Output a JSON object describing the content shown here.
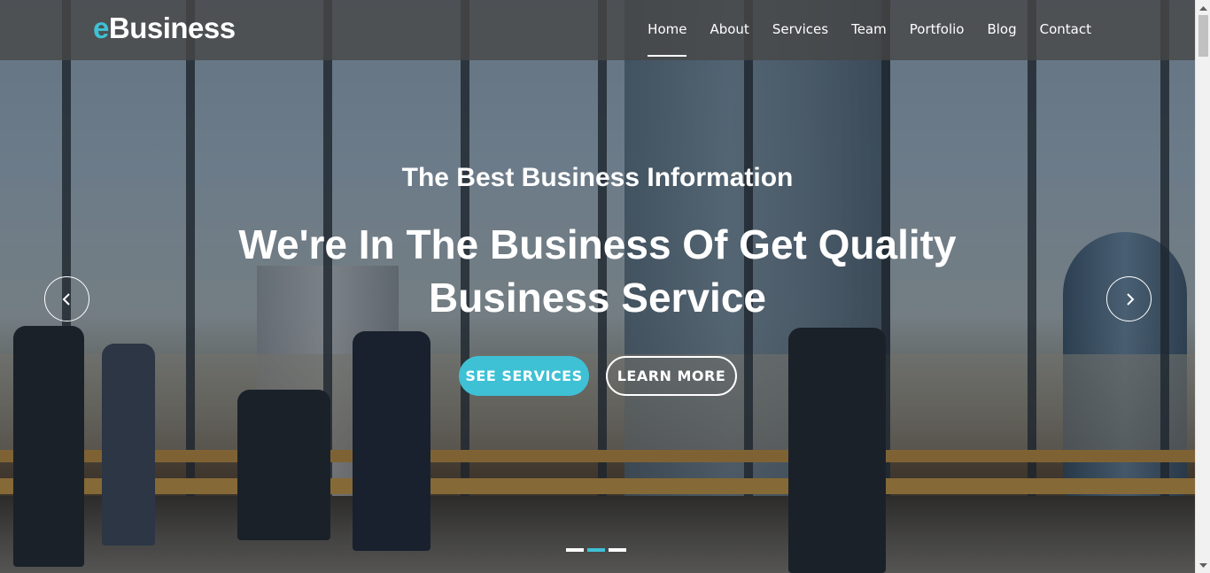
{
  "brand": {
    "logo_accent": "e",
    "logo_rest": "Business",
    "accent_color": "#3ec1d5"
  },
  "nav": {
    "items": [
      {
        "label": "Home",
        "active": true
      },
      {
        "label": "About"
      },
      {
        "label": "Services"
      },
      {
        "label": "Team"
      },
      {
        "label": "Portfolio"
      },
      {
        "label": "Blog"
      },
      {
        "label": "Contact"
      }
    ]
  },
  "slider": {
    "subtitle": "The Best Business Information",
    "title": "We're In The Business Of Get Quality Business Service",
    "primary_button": "SEE SERVICES",
    "secondary_button": "LEARN MORE",
    "prev_icon": "chevron-left-icon",
    "next_icon": "chevron-right-icon",
    "slide_count": 3,
    "active_slide": 2
  }
}
